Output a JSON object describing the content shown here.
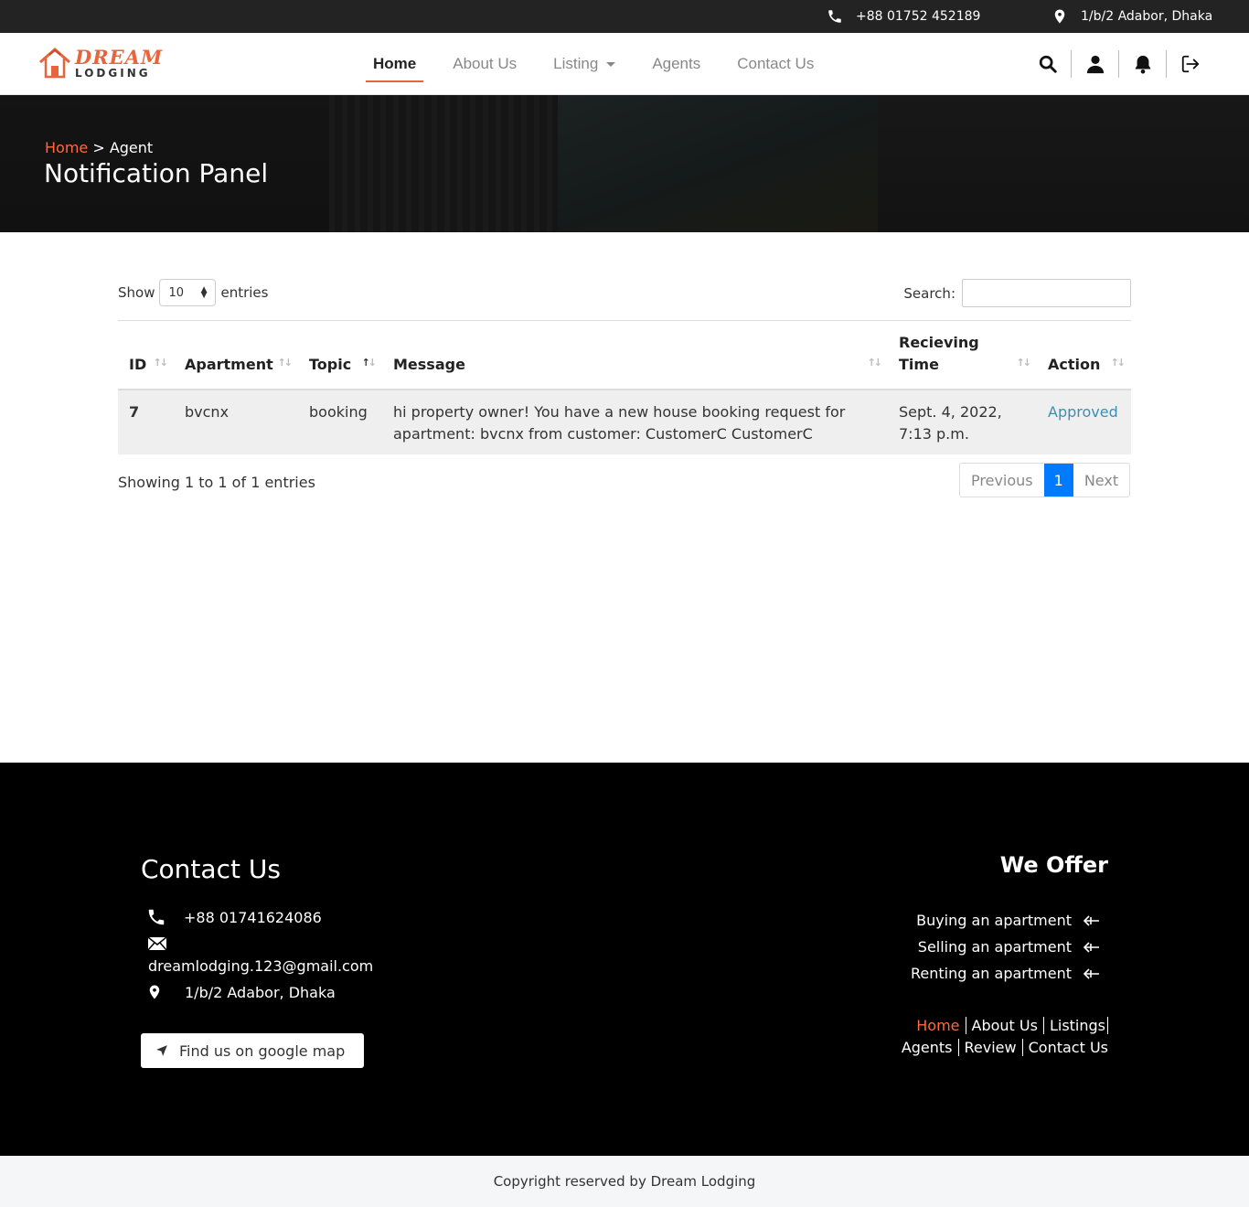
{
  "topbar": {
    "phone": "+88 01752 452189",
    "address": "1/b/2 Adabor, Dhaka"
  },
  "logo": {
    "top": "DREAM",
    "bottom": "LODGING"
  },
  "nav": {
    "home": "Home",
    "about": "About Us",
    "listing": "Listing",
    "agents": "Agents",
    "contact": "Contact Us",
    "icons": [
      "search-icon",
      "user-icon",
      "bell-icon",
      "logout-icon"
    ]
  },
  "hero": {
    "crumb_home": "Home",
    "crumb_sep": " > ",
    "crumb_current": "Agent",
    "title": "Notification Panel"
  },
  "table": {
    "show_label": "Show",
    "show_value": "10",
    "entries_label": "entries",
    "search_label": "Search:",
    "headers": [
      "ID",
      "Apartment",
      "Topic",
      "Message",
      "Recieving Time",
      "Action"
    ],
    "rows": [
      {
        "id": "7",
        "apartment": "bvcnx",
        "topic": "booking",
        "message": "hi property owner! You have a new house booking request for apartment: bvcnx from customer: CustomerC CustomerC",
        "time": "Sept. 4, 2022, 7:13 p.m.",
        "action": "Approved"
      }
    ],
    "info": "Showing 1 to 1 of 1 entries",
    "prev": "Previous",
    "page": "1",
    "next": "Next"
  },
  "footer": {
    "contact_title": "Contact Us",
    "phone": "+88 01741624086",
    "email": "dreamlodging.123@gmail.com",
    "address": "1/b/2 Adabor, Dhaka",
    "map_button": "Find us on google map",
    "offer_title": "We Offer",
    "offers": [
      "Buying an apartment",
      "Selling an apartment",
      "Renting an apartment"
    ],
    "links": [
      "Home",
      "About Us",
      "Listings",
      "Agents",
      "Review",
      "Contact Us"
    ]
  },
  "copyright": "Copyright reserved by Dream Lodging",
  "colors": {
    "accent": "#e8643c",
    "link": "#3b8fb3",
    "page_active": "#007bff"
  }
}
